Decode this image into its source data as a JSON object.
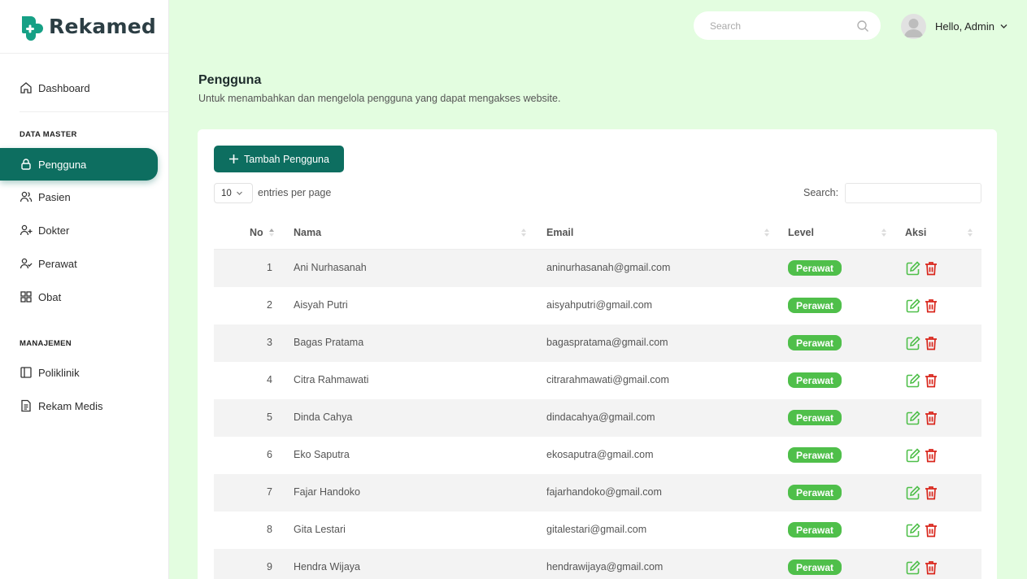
{
  "brand": {
    "name": "Rekamed",
    "color": "#16a085"
  },
  "header": {
    "search_placeholder": "Search",
    "user_greeting": "Hello, Admin"
  },
  "sidebar": {
    "dashboard": "Dashboard",
    "section_master": "DATA MASTER",
    "items_master": [
      {
        "label": "Pengguna",
        "icon": "lock-icon",
        "active": true
      },
      {
        "label": "Pasien",
        "icon": "users-icon"
      },
      {
        "label": "Dokter",
        "icon": "user-plus-icon"
      },
      {
        "label": "Perawat",
        "icon": "user-check-icon"
      },
      {
        "label": "Obat",
        "icon": "grid-icon"
      }
    ],
    "section_manage": "MANAJEMEN",
    "items_manage": [
      {
        "label": "Poliklinik",
        "icon": "sidebar-layout-icon"
      },
      {
        "label": "Rekam Medis",
        "icon": "document-icon"
      }
    ]
  },
  "page": {
    "title": "Pengguna",
    "subtitle": "Untuk menambahkan dan mengelola pengguna yang dapat mengakses website."
  },
  "toolbar": {
    "add_label": "Tambah Pengguna",
    "page_size": "10",
    "entries_label": "entries per page",
    "search_label": "Search:"
  },
  "table": {
    "columns": [
      "No",
      "Nama",
      "Email",
      "Level",
      "Aksi"
    ],
    "rows": [
      {
        "no": "1",
        "nama": "Ani Nurhasanah",
        "email": "aninurhasanah@gmail.com",
        "level": "Perawat"
      },
      {
        "no": "2",
        "nama": "Aisyah Putri",
        "email": "aisyahputri@gmail.com",
        "level": "Perawat"
      },
      {
        "no": "3",
        "nama": "Bagas Pratama",
        "email": "bagaspratama@gmail.com",
        "level": "Perawat"
      },
      {
        "no": "4",
        "nama": "Citra Rahmawati",
        "email": "citrarahmawati@gmail.com",
        "level": "Perawat"
      },
      {
        "no": "5",
        "nama": "Dinda Cahya",
        "email": "dindacahya@gmail.com",
        "level": "Perawat"
      },
      {
        "no": "6",
        "nama": "Eko Saputra",
        "email": "ekosaputra@gmail.com",
        "level": "Perawat"
      },
      {
        "no": "7",
        "nama": "Fajar Handoko",
        "email": "fajarhandoko@gmail.com",
        "level": "Perawat"
      },
      {
        "no": "8",
        "nama": "Gita Lestari",
        "email": "gitalestari@gmail.com",
        "level": "Perawat"
      },
      {
        "no": "9",
        "nama": "Hendra Wijaya",
        "email": "hendrawijaya@gmail.com",
        "level": "Perawat"
      }
    ]
  },
  "colors": {
    "primary": "#0d6e60",
    "badge": "#4fbf4a",
    "edit": "#4fbf4a",
    "delete": "#d9261c",
    "background": "#e3fde0"
  }
}
